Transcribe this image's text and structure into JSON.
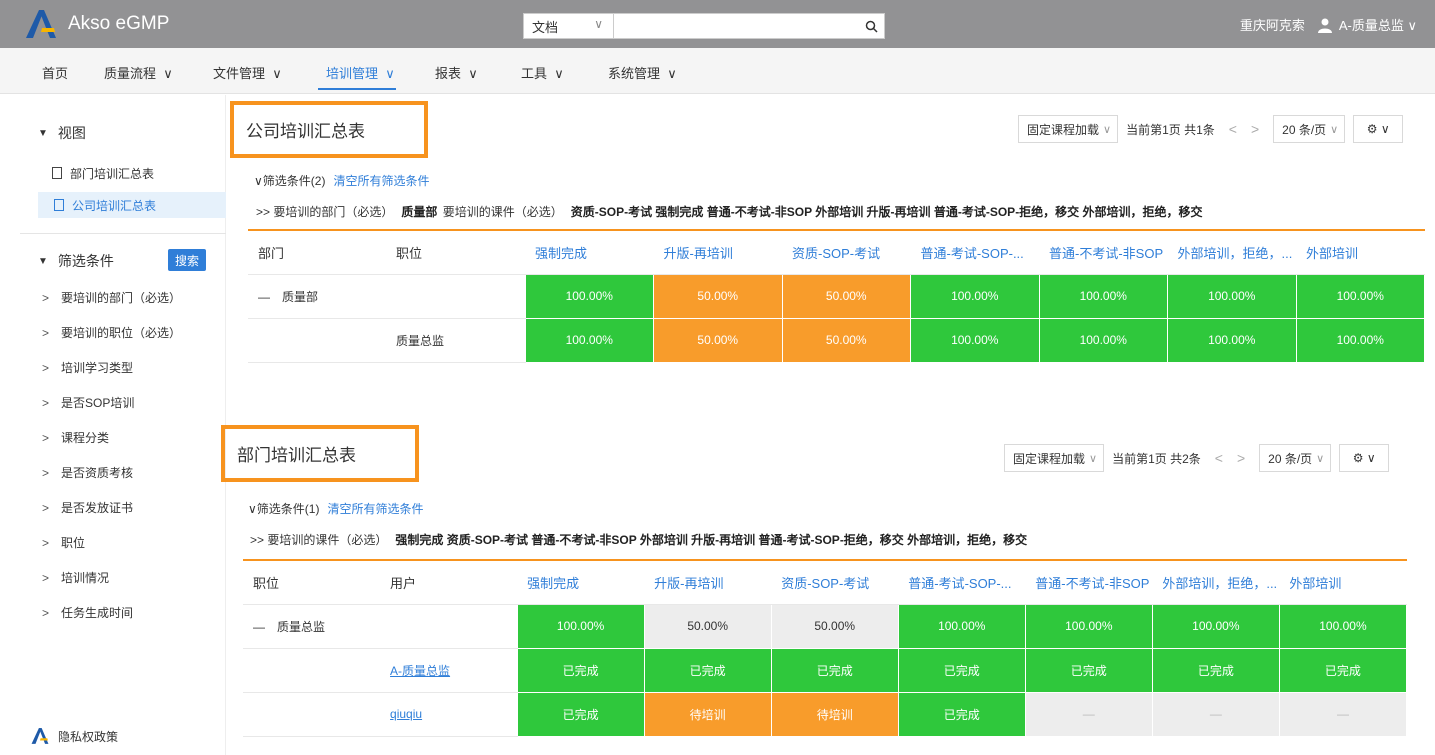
{
  "app": {
    "name": "Akso eGMP",
    "company": "重庆阿克索",
    "user": "A-质量总监"
  },
  "search": {
    "scope": "文档",
    "placeholder": ""
  },
  "nav": [
    {
      "label": "首页"
    },
    {
      "label": "质量流程"
    },
    {
      "label": "文件管理"
    },
    {
      "label": "培训管理"
    },
    {
      "label": "报表"
    },
    {
      "label": "工具"
    },
    {
      "label": "系统管理"
    }
  ],
  "sidebar": {
    "view_title": "视图",
    "views": [
      {
        "label": "部门培训汇总表"
      },
      {
        "label": "公司培训汇总表"
      }
    ],
    "filter_title": "筛选条件",
    "search_btn": "搜索",
    "filters": [
      {
        "label": "要培训的部门（必选）"
      },
      {
        "label": "要培训的职位（必选）"
      },
      {
        "label": "培训学习类型"
      },
      {
        "label": "是否SOP培训"
      },
      {
        "label": "课程分类"
      },
      {
        "label": "是否资质考核"
      },
      {
        "label": "是否发放证书"
      },
      {
        "label": "职位"
      },
      {
        "label": "培训情况"
      },
      {
        "label": "任务生成时间"
      }
    ],
    "footer": "隐私权政策"
  },
  "panel1": {
    "title": "公司培训汇总表",
    "load_mode": "固定课程加载",
    "page_info": "当前第1页 共1条",
    "page_size": "20 条/页",
    "filter_label": "筛选条件(2)",
    "clear_label": "清空所有筛选条件",
    "crumb_prefix": ">> 要培训的部门（必选）",
    "crumb_dept": "质量部",
    "crumb_course_label": "要培训的课件（必选）",
    "crumb_courses": "资质-SOP-考试  强制完成  普通-不考试-非SOP  外部培训  升版-再培训  普通-考试-SOP-拒绝，移交  外部培训，拒绝，移交",
    "columns": [
      "部门",
      "职位",
      "强制完成",
      "升版-再培训",
      "资质-SOP-考试",
      "普通-考试-SOP-...",
      "普通-不考试-非SOP",
      "外部培训，拒绝，...",
      "外部培训"
    ],
    "rows": [
      {
        "c0": "质量部",
        "c1": "",
        "cells": [
          "100.00%",
          "50.00%",
          "50.00%",
          "100.00%",
          "100.00%",
          "100.00%",
          "100.00%"
        ]
      },
      {
        "c0": "",
        "c1": "质量总监",
        "cells": [
          "100.00%",
          "50.00%",
          "50.00%",
          "100.00%",
          "100.00%",
          "100.00%",
          "100.00%"
        ]
      }
    ]
  },
  "panel2": {
    "title": "部门培训汇总表",
    "load_mode": "固定课程加载",
    "page_info": "当前第1页 共2条",
    "page_size": "20 条/页",
    "filter_label": "筛选条件(1)",
    "clear_label": "清空所有筛选条件",
    "crumb_prefix": ">> 要培训的课件（必选）",
    "crumb_courses": "强制完成  资质-SOP-考试  普通-不考试-非SOP  外部培训  升版-再培训  普通-考试-SOP-拒绝，移交  外部培训，拒绝，移交",
    "columns": [
      "职位",
      "用户",
      "强制完成",
      "升版-再培训",
      "资质-SOP-考试",
      "普通-考试-SOP-...",
      "普通-不考试-非SOP",
      "外部培训，拒绝，...",
      "外部培训"
    ],
    "rows": [
      {
        "c0": "质量总监",
        "c1": "",
        "cells": [
          "100.00%",
          "50.00%",
          "50.00%",
          "100.00%",
          "100.00%",
          "100.00%",
          "100.00%"
        ]
      },
      {
        "c0": "",
        "c1": "A-质量总监",
        "cells": [
          "已完成",
          "已完成",
          "已完成",
          "已完成",
          "已完成",
          "已完成",
          "已完成"
        ]
      },
      {
        "c0": "",
        "c1": "qiuqiu",
        "cells": [
          "已完成",
          "待培训",
          "待培训",
          "已完成",
          "—",
          "—",
          "—"
        ]
      }
    ]
  },
  "colors": {
    "accent": "#2f7ed8",
    "highlight": "#f7931e",
    "green": "#2fc83c",
    "orange": "#f89c2b"
  }
}
